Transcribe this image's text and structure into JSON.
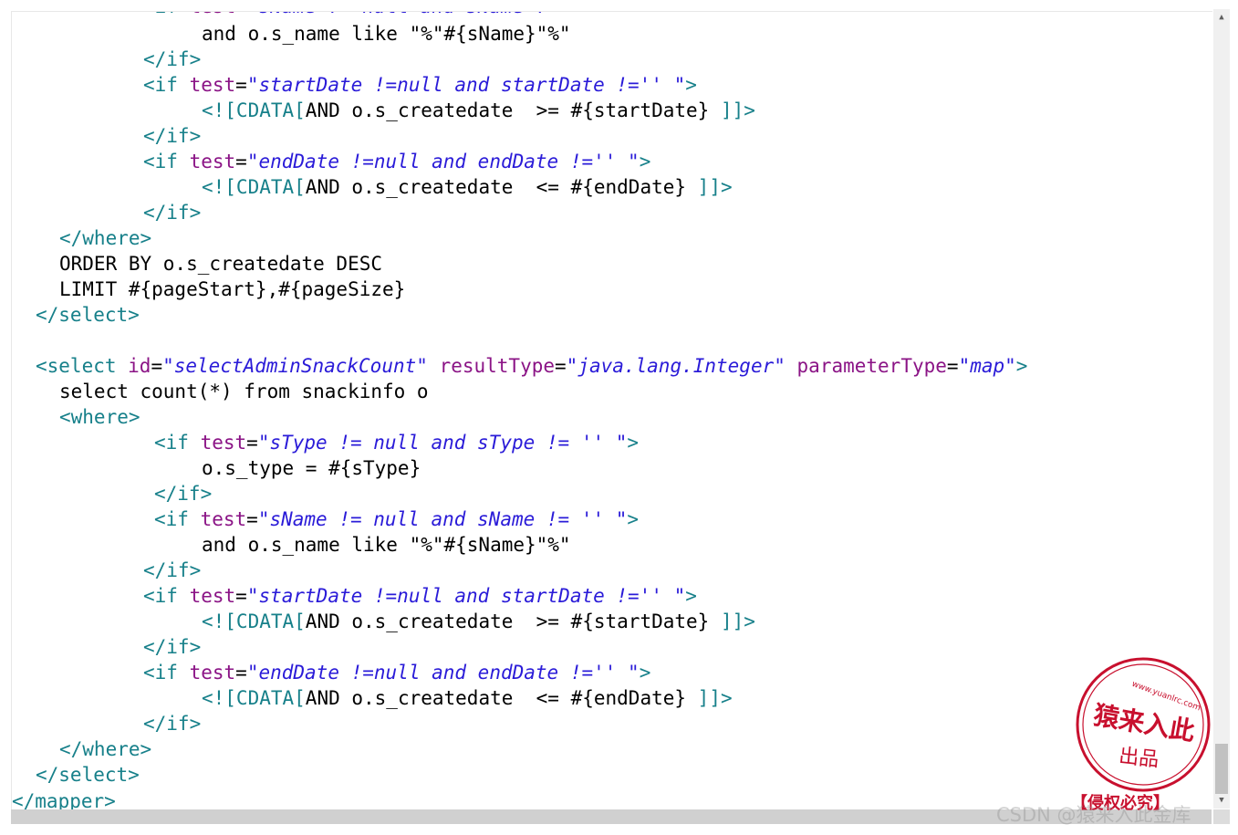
{
  "scrollbar": {
    "up_arrow_icon": "triangle-up-icon",
    "down_arrow_icon": "triangle-down-icon",
    "position_fraction": 0.95
  },
  "colors": {
    "tag": "#17808a",
    "attribute": "#8b1486",
    "attribute_value": "#2a1bd8",
    "text": "#000000",
    "stamp_red": "#c8102e"
  },
  "code_lines": [
    [
      {
        "t": "tag",
        "s": "<if "
      },
      {
        "t": "attr",
        "s": "test"
      },
      {
        "t": "eq",
        "s": "="
      },
      {
        "t": "val",
        "s": "\"sName != null and sName != '' \""
      },
      {
        "t": "tag",
        "s": ">"
      }
    ],
    [
      {
        "t": "text",
        "s": "and o.s_name like \"%\"#{sName}\"%\""
      }
    ],
    [
      {
        "t": "tag",
        "s": "</if>"
      }
    ],
    [
      {
        "t": "tag",
        "s": "<if "
      },
      {
        "t": "attr",
        "s": "test"
      },
      {
        "t": "eq",
        "s": "="
      },
      {
        "t": "val",
        "s": "\"startDate !=null and startDate !='' \""
      },
      {
        "t": "tag",
        "s": ">"
      }
    ],
    [
      {
        "t": "cdata",
        "s": "<![CDATA["
      },
      {
        "t": "text",
        "s": "AND o.s_createdate  >= #{startDate} "
      },
      {
        "t": "cdata",
        "s": "]]>"
      }
    ],
    [
      {
        "t": "tag",
        "s": "</if>"
      }
    ],
    [
      {
        "t": "tag",
        "s": "<if "
      },
      {
        "t": "attr",
        "s": "test"
      },
      {
        "t": "eq",
        "s": "="
      },
      {
        "t": "val",
        "s": "\"endDate !=null and endDate !='' \""
      },
      {
        "t": "tag",
        "s": ">"
      }
    ],
    [
      {
        "t": "cdata",
        "s": "<![CDATA["
      },
      {
        "t": "text",
        "s": "AND o.s_createdate  <= #{endDate} "
      },
      {
        "t": "cdata",
        "s": "]]>"
      }
    ],
    [
      {
        "t": "tag",
        "s": "</if>"
      }
    ],
    [
      {
        "t": "tag",
        "s": "</where>"
      }
    ],
    [
      {
        "t": "text",
        "s": "ORDER BY o.s_createdate DESC"
      }
    ],
    [
      {
        "t": "text",
        "s": "LIMIT #{pageStart},#{pageSize}"
      }
    ],
    [
      {
        "t": "tag",
        "s": "</select>"
      }
    ],
    [],
    [
      {
        "t": "tag",
        "s": "<select "
      },
      {
        "t": "attr",
        "s": "id"
      },
      {
        "t": "eq",
        "s": "="
      },
      {
        "t": "val",
        "s": "\"selectAdminSnackCount\""
      },
      {
        "t": "tag",
        "s": " "
      },
      {
        "t": "attr",
        "s": "resultType"
      },
      {
        "t": "eq",
        "s": "="
      },
      {
        "t": "val",
        "s": "\"java.lang.Integer\""
      },
      {
        "t": "tag",
        "s": " "
      },
      {
        "t": "attr",
        "s": "parameterType"
      },
      {
        "t": "eq",
        "s": "="
      },
      {
        "t": "val",
        "s": "\"map\""
      },
      {
        "t": "tag",
        "s": ">"
      }
    ],
    [
      {
        "t": "text",
        "s": "select count(*) from snackinfo o"
      }
    ],
    [
      {
        "t": "tag",
        "s": "<where>"
      }
    ],
    [
      {
        "t": "tag",
        "s": "<if "
      },
      {
        "t": "attr",
        "s": "test"
      },
      {
        "t": "eq",
        "s": "="
      },
      {
        "t": "val",
        "s": "\"sType != null and sType != '' \""
      },
      {
        "t": "tag",
        "s": ">"
      }
    ],
    [
      {
        "t": "text",
        "s": "o.s_type = #{sType}"
      }
    ],
    [
      {
        "t": "tag",
        "s": "</if>"
      }
    ],
    [
      {
        "t": "tag",
        "s": "<if "
      },
      {
        "t": "attr",
        "s": "test"
      },
      {
        "t": "eq",
        "s": "="
      },
      {
        "t": "val",
        "s": "\"sName != null and sName != '' \""
      },
      {
        "t": "tag",
        "s": ">"
      }
    ],
    [
      {
        "t": "text",
        "s": "and o.s_name like \"%\"#{sName}\"%\""
      }
    ],
    [
      {
        "t": "tag",
        "s": "</if>"
      }
    ],
    [
      {
        "t": "tag",
        "s": "<if "
      },
      {
        "t": "attr",
        "s": "test"
      },
      {
        "t": "eq",
        "s": "="
      },
      {
        "t": "val",
        "s": "\"startDate !=null and startDate !='' \""
      },
      {
        "t": "tag",
        "s": ">"
      }
    ],
    [
      {
        "t": "cdata",
        "s": "<![CDATA["
      },
      {
        "t": "text",
        "s": "AND o.s_createdate  >= #{startDate} "
      },
      {
        "t": "cdata",
        "s": "]]>"
      }
    ],
    [
      {
        "t": "tag",
        "s": "</if>"
      }
    ],
    [
      {
        "t": "tag",
        "s": "<if "
      },
      {
        "t": "attr",
        "s": "test"
      },
      {
        "t": "eq",
        "s": "="
      },
      {
        "t": "val",
        "s": "\"endDate !=null and endDate !='' \""
      },
      {
        "t": "tag",
        "s": ">"
      }
    ],
    [
      {
        "t": "cdata",
        "s": "<![CDATA["
      },
      {
        "t": "text",
        "s": "AND o.s_createdate  <= #{endDate} "
      },
      {
        "t": "cdata",
        "s": "]]>"
      }
    ],
    [
      {
        "t": "tag",
        "s": "</if>"
      }
    ],
    [
      {
        "t": "tag",
        "s": "</where>"
      }
    ],
    [
      {
        "t": "tag",
        "s": "</select>"
      }
    ],
    [
      {
        "t": "tag",
        "s": "</mapper>"
      }
    ]
  ],
  "watermark": "CSDN @猿来入此金库",
  "stamp": {
    "url": "www.yuanlrc.com",
    "main": "猿来入此",
    "sub": "出品",
    "banner": "【侵权必究】"
  }
}
